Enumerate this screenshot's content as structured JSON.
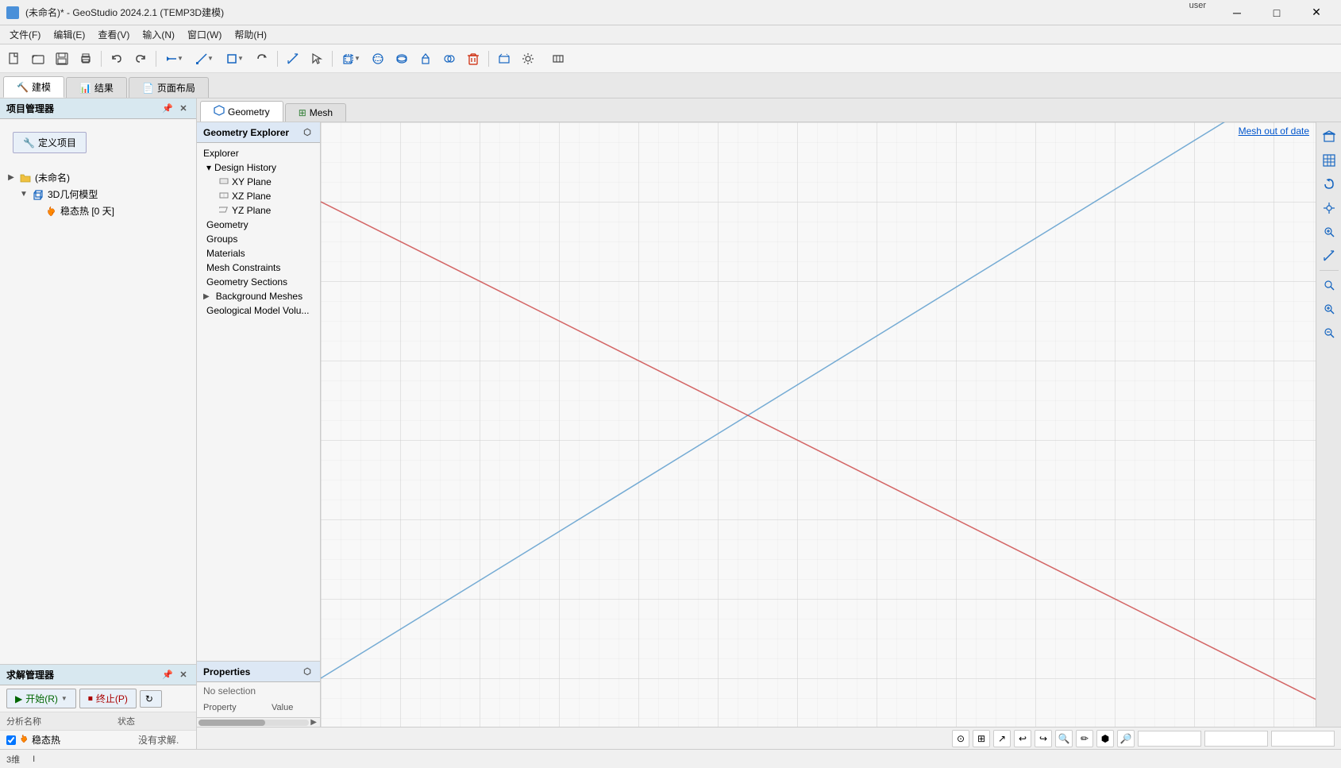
{
  "window": {
    "title": "(未命名)* - GeoStudio 2024.2.1 (TEMP3D建模)",
    "icon": "⬛"
  },
  "titlebar": {
    "min": "─",
    "max": "□",
    "close": "✕",
    "user": "user"
  },
  "menubar": {
    "items": [
      "文件(F)",
      "编辑(E)",
      "查看(V)",
      "输入(N)",
      "窗口(W)",
      "帮助(H)"
    ]
  },
  "toolbar": {
    "buttons": [
      "new",
      "open",
      "save",
      "print",
      "undo",
      "redo",
      "sketch",
      "line",
      "shape",
      "rotate",
      "measure",
      "select",
      "box",
      "sphere",
      "torus",
      "extrude",
      "boolean",
      "delete",
      "plane",
      "settings"
    ]
  },
  "main_tabs": [
    {
      "label": "建模",
      "icon": "🔨",
      "active": true
    },
    {
      "label": "结果",
      "icon": "📊",
      "active": false
    },
    {
      "label": "页面布局",
      "icon": "📄",
      "active": false
    }
  ],
  "project_manager": {
    "title": "项目管理器",
    "define_project_btn": "定义项目",
    "tree": [
      {
        "label": "(未命名)",
        "level": 0,
        "expand": true,
        "icon": "folder"
      },
      {
        "label": "3D几何模型",
        "level": 1,
        "expand": true,
        "icon": "cube"
      },
      {
        "label": "稳态热 [0 天]",
        "level": 2,
        "expand": false,
        "icon": "flame"
      }
    ]
  },
  "solver_manager": {
    "title": "求解管理器",
    "start_btn": "开始(R)",
    "stop_btn": "终止(P)",
    "refresh_icon": "↻",
    "columns": [
      "分析名称",
      "状态"
    ],
    "rows": [
      {
        "name": "稳态热",
        "status": "没有求解."
      }
    ]
  },
  "geometry_explorer": {
    "title": "Geometry Explorer",
    "expand_icon": "⬡",
    "items": [
      {
        "label": "Explorer",
        "level": 0,
        "type": "header"
      },
      {
        "label": "Design History",
        "level": 1,
        "type": "section",
        "expanded": true,
        "icon": "▾"
      },
      {
        "label": "XY Plane",
        "level": 2,
        "type": "subsection",
        "icon": "plane"
      },
      {
        "label": "XZ Plane",
        "level": 2,
        "type": "subsection",
        "icon": "plane"
      },
      {
        "label": "YZ Plane",
        "level": 2,
        "type": "subsection",
        "icon": "plane"
      },
      {
        "label": "Geometry",
        "level": 1,
        "type": "section"
      },
      {
        "label": "Groups",
        "level": 1,
        "type": "section"
      },
      {
        "label": "Materials",
        "level": 1,
        "type": "section"
      },
      {
        "label": "Mesh Constraints",
        "level": 1,
        "type": "section"
      },
      {
        "label": "Geometry Sections",
        "level": 1,
        "type": "section"
      },
      {
        "label": "Background Meshes",
        "level": 1,
        "type": "section",
        "expand": "▶"
      },
      {
        "label": "Geological Model Volu...",
        "level": 1,
        "type": "section"
      }
    ]
  },
  "geo_tabs": [
    {
      "label": "Geometry",
      "icon": "◇",
      "active": true
    },
    {
      "label": "Mesh",
      "icon": "⊞",
      "active": false
    }
  ],
  "properties": {
    "title": "Properties",
    "no_selection": "No selection",
    "columns": [
      "Property",
      "Value"
    ]
  },
  "viewport": {
    "mesh_out_of_date": "Mesh out of date"
  },
  "right_tools": [
    "↕",
    "⊞",
    "↗",
    "⟲",
    "🔍",
    "✏",
    "📐",
    "🔎"
  ],
  "viewport_bottom": {
    "btns": [
      "⊙",
      "⊞",
      "↗",
      "⟲",
      "⟲",
      "🔍",
      "✏",
      "⬢",
      "🔎"
    ]
  },
  "status_bar": {
    "items": [
      "3维",
      "I"
    ]
  }
}
